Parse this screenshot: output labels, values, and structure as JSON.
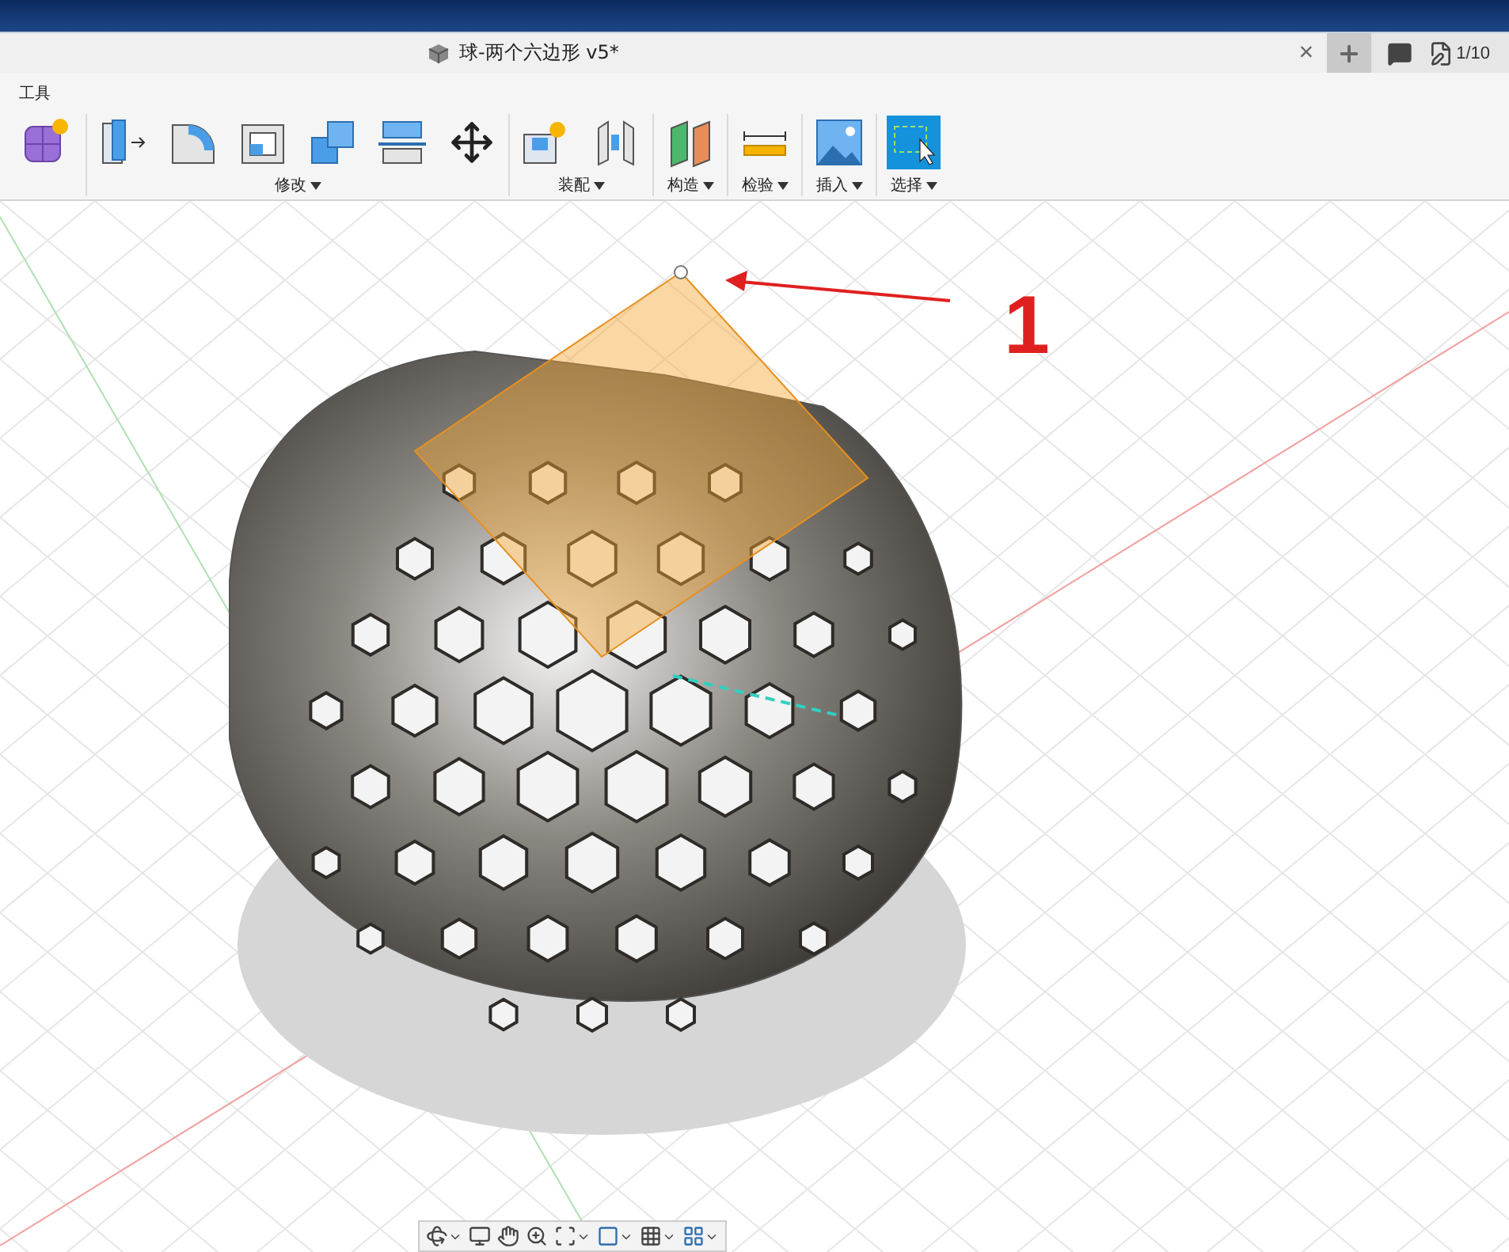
{
  "document_tab": {
    "title": "球-两个六边形 v5*",
    "close": "×"
  },
  "header": {
    "job_status": "1/10"
  },
  "toolbar": {
    "workspace_label": "工具",
    "groups": [
      {
        "label": "修改"
      },
      {
        "label": "装配"
      },
      {
        "label": "构造"
      },
      {
        "label": "检验"
      },
      {
        "label": "插入"
      },
      {
        "label": "选择"
      }
    ]
  },
  "canvas": {
    "annotation": "1"
  }
}
